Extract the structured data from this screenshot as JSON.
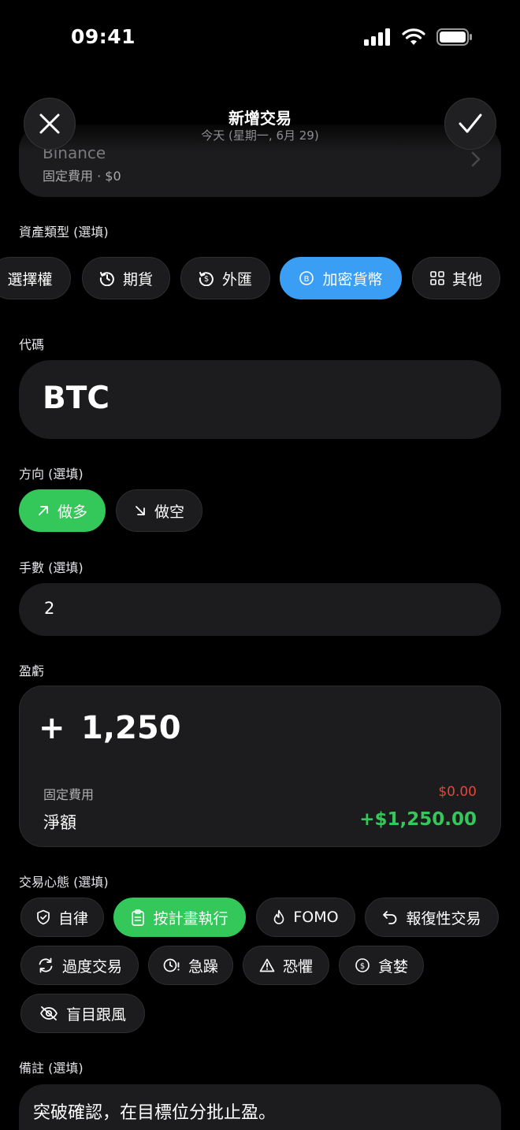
{
  "status_bar": {
    "time": "09:41"
  },
  "header": {
    "title": "新增交易",
    "date": "今天 (星期一, 6月 29)",
    "close_icon": "close-icon",
    "confirm_icon": "checkmark-icon"
  },
  "broker": {
    "name": "Binance",
    "fee": "固定費用 · $0"
  },
  "asset_type": {
    "label": "資產類型 (選填)",
    "options": [
      {
        "label": "選擇權",
        "icon": "",
        "active": false
      },
      {
        "label": "期貨",
        "icon": "history-icon",
        "active": false
      },
      {
        "label": "外匯",
        "icon": "currency-exchange-icon",
        "active": false
      },
      {
        "label": "加密貨幣",
        "icon": "bitcoin-icon",
        "active": true
      },
      {
        "label": "其他",
        "icon": "grid-icon",
        "active": false
      }
    ]
  },
  "ticker": {
    "label": "代碼",
    "value": "BTC"
  },
  "direction": {
    "label": "方向 (選填)",
    "options": [
      {
        "label": "做多",
        "icon": "arrow-up-right-icon",
        "active": true
      },
      {
        "label": "做空",
        "icon": "arrow-down-right-icon",
        "active": false
      }
    ]
  },
  "lots": {
    "label": "手數 (選填)",
    "value": "2"
  },
  "pnl": {
    "label": "盈虧",
    "sign": "+",
    "amount": "1,250",
    "fee_label": "固定費用",
    "fee_value": "$0.00",
    "net_label": "淨額",
    "net_value": "+$1,250.00"
  },
  "mindset": {
    "label": "交易心態 (選填)",
    "tags": [
      {
        "label": "自律",
        "icon": "shield-check-icon",
        "active": false
      },
      {
        "label": "按計畫執行",
        "icon": "clipboard-icon",
        "active": true
      },
      {
        "label": "FOMO",
        "icon": "flame-icon",
        "active": false
      },
      {
        "label": "報復性交易",
        "icon": "undo-arrow-icon",
        "active": false
      },
      {
        "label": "過度交易",
        "icon": "refresh-icon",
        "active": false
      },
      {
        "label": "急躁",
        "icon": "clock-alert-icon",
        "active": false
      },
      {
        "label": "恐懼",
        "icon": "warning-icon",
        "active": false
      },
      {
        "label": "貪婪",
        "icon": "dollar-coin-icon",
        "active": false
      },
      {
        "label": "盲目跟風",
        "icon": "eye-off-icon",
        "active": false
      }
    ]
  },
  "notes": {
    "label": "備註 (選填)",
    "value": "突破確認，在目標位分批止盈。"
  },
  "colors": {
    "accent_blue": "#3a9ef5",
    "accent_green": "#34c759",
    "fee_red": "#e0483e",
    "surface": "#1c1c1e"
  }
}
